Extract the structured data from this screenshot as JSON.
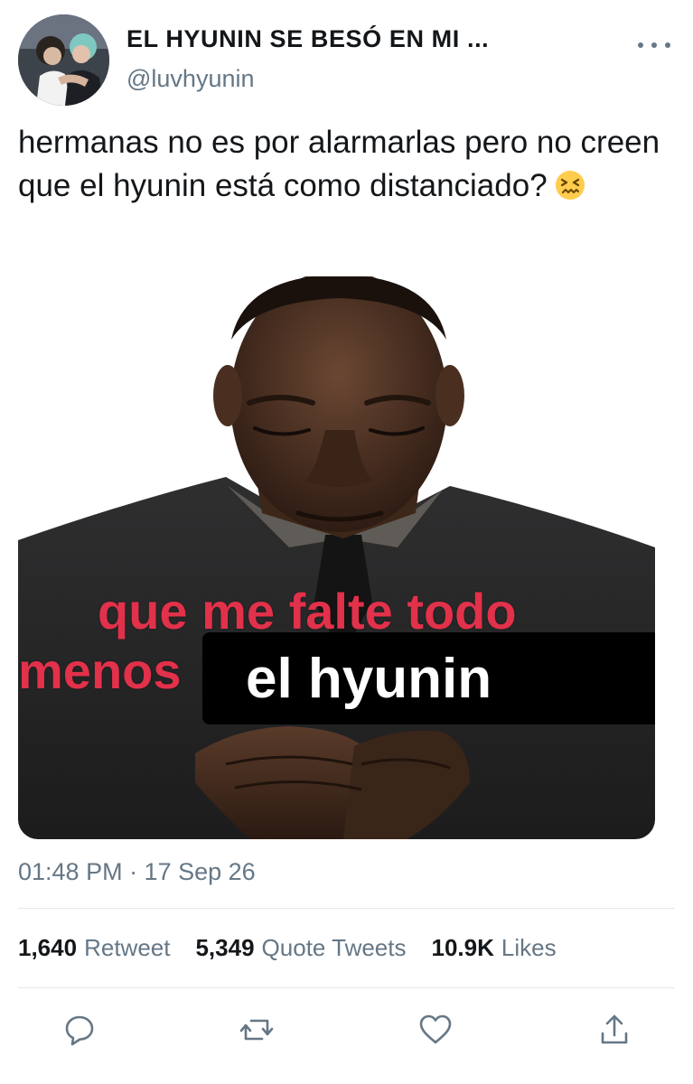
{
  "user": {
    "display_name": "EL HYUNIN SE BESÓ EN MI ...",
    "handle": "@luvhyunin"
  },
  "tweet": {
    "text": "hermanas no es por alarmarlas pero no creen que el hyunin está como distanciado?",
    "emoji": "confounded-face"
  },
  "meme": {
    "line1": "que me falte todo",
    "line2": "menos",
    "caption": "el hyunin"
  },
  "timestamp": "01:48 PM · 17 Sep 26",
  "stats": {
    "retweets_count": "1,640",
    "retweets_label": "Retweet",
    "quotes_count": "5,349",
    "quotes_label": "Quote Tweets",
    "likes_count": "10.9K",
    "likes_label": "Likes"
  },
  "actions": [
    {
      "icon": "reply-icon"
    },
    {
      "icon": "retweet-icon"
    },
    {
      "icon": "like-icon"
    },
    {
      "icon": "share-icon"
    }
  ],
  "colors": {
    "text": "#14171a",
    "secondary": "#657786",
    "divider": "#e1e8ed",
    "meme_red": "#e2314a"
  }
}
